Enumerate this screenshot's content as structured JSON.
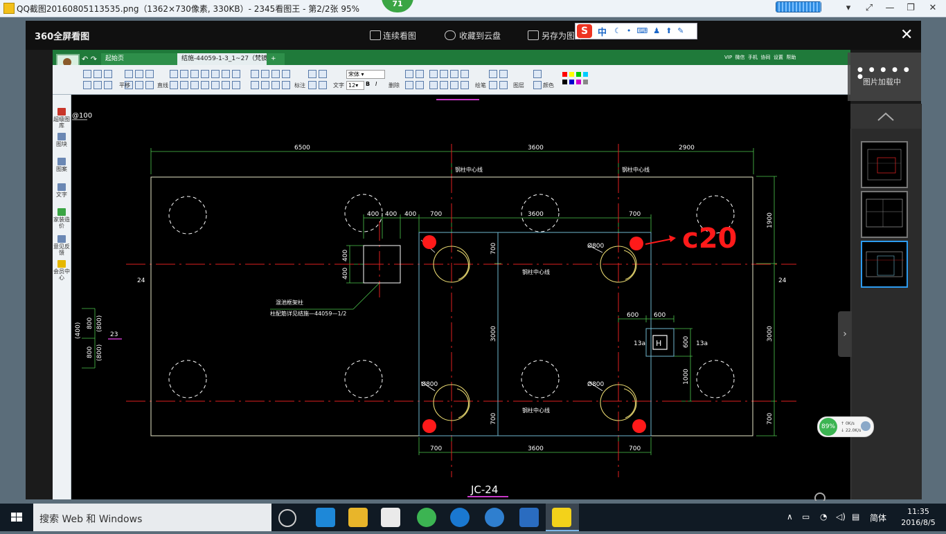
{
  "window": {
    "title": "QQ截图20160805113535.png（1362×730像素, 330KB）- 2345看图王 - 第2/2张 95%",
    "badge": "71"
  },
  "viewer": {
    "logo": "360全屏看图",
    "actions": [
      "连续看图",
      "收藏到云盘",
      "另存为图片"
    ],
    "close": "✕"
  },
  "ime": {
    "brand": "S",
    "mode": "中"
  },
  "cad": {
    "tabs": [
      "起始页",
      "结施-44059-1-3_1~27（梵镜...",
      "+"
    ],
    "top_right": [
      "VIP",
      "微信",
      "手机",
      "协同",
      "设置",
      "帮助"
    ],
    "toolbar_labels": [
      "平移",
      "直线",
      "标注",
      "文字",
      "删除",
      "绘笔",
      "图层",
      "颜色"
    ],
    "font_name": "宋体",
    "font_size": "12",
    "sidebar": [
      "超级图库",
      "图块",
      "图案",
      "文字",
      "家装造价",
      "意见反馈",
      "会员中心"
    ],
    "colors": {
      "row1": [
        "#ff0000",
        "#ffff00",
        "#00cc00",
        "#00ccff"
      ],
      "row2": [
        "#000000",
        "#0000cc",
        "#cc00cc",
        "#888888"
      ]
    }
  },
  "drawing": {
    "title": "JC-24",
    "top_label_left": "@100",
    "dims_top": [
      "6500",
      "3600",
      "2900"
    ],
    "dims_inner_top": [
      "400",
      "400",
      "400",
      "700",
      "3600",
      "700"
    ],
    "dims_bottom": [
      "700",
      "3600",
      "700"
    ],
    "dims_right": [
      "1900",
      "3000",
      "700"
    ],
    "dims_inner_vertical": [
      "700",
      "3000",
      "700"
    ],
    "dims_small_left": [
      "400",
      "400"
    ],
    "dims_left_side": [
      "800",
      "(800)",
      "(400)",
      "800",
      "(800)"
    ],
    "dims_col": [
      "600",
      "600",
      "600",
      "1000"
    ],
    "axis_labels": [
      "24",
      "24",
      "23"
    ],
    "steel_col_center": "钢柱中心线",
    "pile_dia": "Ø800",
    "col_tag": "13a",
    "note_line1": "混池框架柱",
    "note_line2": "柱配筋详见结施—44059—1/2",
    "annotation": "c20",
    "annotation_color": "#ff1a1a"
  },
  "side_panel": {
    "loading": "图片加载中",
    "net_percent": "89%",
    "net_up": "0K/s",
    "net_down": "22.0K/s"
  },
  "taskbar": {
    "search": "搜索 Web 和 Windows",
    "ime": "简体",
    "time": "11:35",
    "date": "2016/8/5"
  }
}
